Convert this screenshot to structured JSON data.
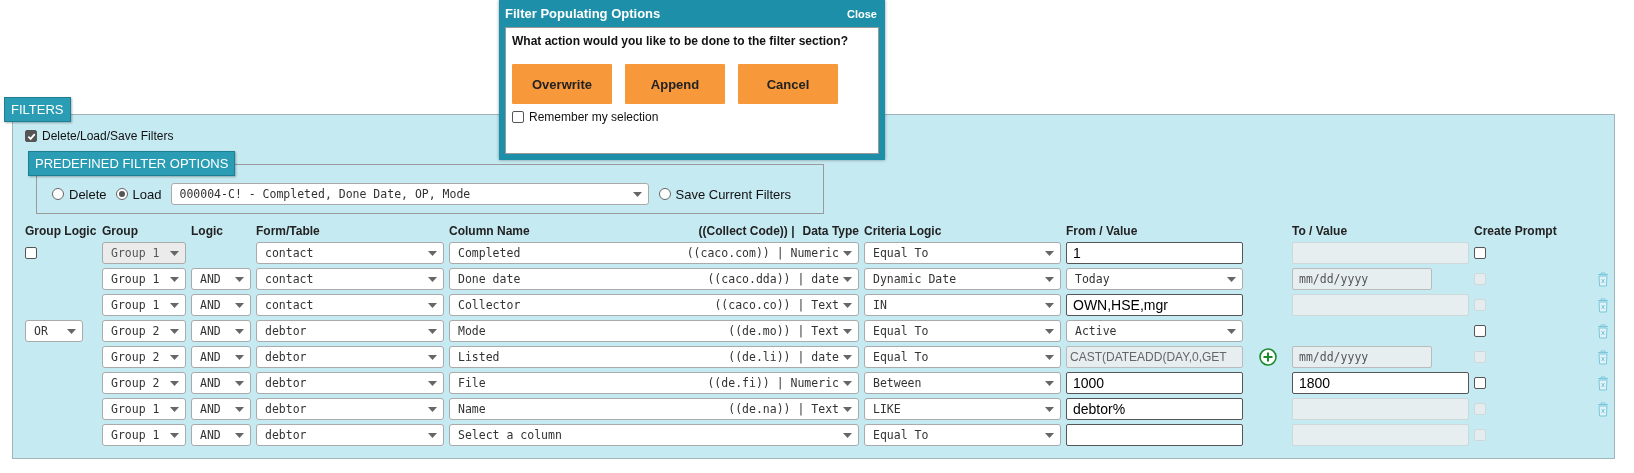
{
  "dialog": {
    "title": "Filter Populating Options",
    "close": "Close",
    "question": "What action would you like to be done to the filter section?",
    "buttons": [
      "Overwrite",
      "Append",
      "Cancel"
    ],
    "remember": {
      "label": "Remember my selection",
      "checked": false
    }
  },
  "filters": {
    "title": "FILTERS",
    "toggle": {
      "label": "Delete/Load/Save Filters",
      "checked": true
    },
    "predefined": {
      "title": "PREDEFINED FILTER OPTIONS",
      "options": [
        {
          "label": "Delete",
          "selected": false
        },
        {
          "label": "Load",
          "selected": true
        }
      ],
      "load_value": "000004-C! - Completed, Done Date, OP, Mode",
      "save": {
        "label": "Save Current Filters",
        "selected": false
      }
    },
    "headers": {
      "group_logic": "Group Logic",
      "group": "Group",
      "logic": "Logic",
      "form": "Form/Table",
      "column": "Column Name",
      "code": "((Collect Code)) |",
      "data_type": "Data Type",
      "criteria": "Criteria Logic",
      "from": "From / Value",
      "to": "To / Value",
      "prompt": "Create Prompt"
    },
    "rows": [
      {
        "group_logic": {
          "kind": "checkbox",
          "checked": false
        },
        "group": {
          "value": "Group 1",
          "disabled": true
        },
        "form": "contact",
        "column": "Completed",
        "code": "((caco.com)) | Numeric",
        "criteria": "Equal To",
        "from": {
          "kind": "input",
          "value": "1"
        },
        "add": false,
        "to": {
          "kind": "blank"
        },
        "prompt": {
          "checked": false,
          "disabled": false
        },
        "delete": false
      },
      {
        "group": {
          "value": "Group 1",
          "disabled": false
        },
        "logic": "AND",
        "form": "contact",
        "column": "Done date",
        "code": "((caco.dda)) | date",
        "criteria": "Dynamic Date",
        "from": {
          "kind": "select",
          "value": "Today"
        },
        "add": false,
        "to": {
          "kind": "date",
          "placeholder": "mm/dd/yyyy"
        },
        "prompt": {
          "checked": false,
          "disabled": true
        },
        "delete": true
      },
      {
        "group": {
          "value": "Group 1",
          "disabled": false
        },
        "logic": "AND",
        "form": "contact",
        "column": "Collector",
        "code": "((caco.co)) | Text",
        "criteria": "IN",
        "from": {
          "kind": "input",
          "value": "OWN,HSE,mgr"
        },
        "add": false,
        "to": {
          "kind": "blank"
        },
        "prompt": {
          "checked": false,
          "disabled": true
        },
        "delete": true
      },
      {
        "group_logic": {
          "kind": "select",
          "value": "OR"
        },
        "group": {
          "value": "Group 2",
          "disabled": false
        },
        "logic": "AND",
        "form": "debtor",
        "column": "Mode",
        "code": "((de.mo)) | Text",
        "criteria": "Equal To",
        "from": {
          "kind": "select",
          "value": "Active"
        },
        "add": false,
        "prompt": {
          "checked": false,
          "disabled": false
        },
        "delete": true
      },
      {
        "group": {
          "value": "Group 2",
          "disabled": false
        },
        "logic": "AND",
        "form": "debtor",
        "column": "Listed",
        "code": "((de.li)) | date",
        "criteria": "Equal To",
        "from": {
          "kind": "readonly",
          "value": "CAST(DATEADD(DAY,0,GET"
        },
        "add": true,
        "to": {
          "kind": "date",
          "placeholder": "mm/dd/yyyy"
        },
        "prompt": {
          "checked": false,
          "disabled": true
        },
        "delete": true
      },
      {
        "group": {
          "value": "Group 2",
          "disabled": false
        },
        "logic": "AND",
        "form": "debtor",
        "column": "File",
        "code": "((de.fi)) | Numeric",
        "criteria": "Between",
        "from": {
          "kind": "input",
          "value": "1000"
        },
        "add": false,
        "to": {
          "kind": "input",
          "value": "1800"
        },
        "prompt": {
          "checked": false,
          "disabled": false
        },
        "delete": true
      },
      {
        "group": {
          "value": "Group 1",
          "disabled": false
        },
        "logic": "AND",
        "form": "debtor",
        "column": "Name",
        "code": "((de.na)) | Text",
        "criteria": "LIKE",
        "from": {
          "kind": "input",
          "value": "debtor%"
        },
        "add": false,
        "to": {
          "kind": "blank"
        },
        "prompt": {
          "checked": false,
          "disabled": true
        },
        "delete": true
      },
      {
        "group": {
          "value": "Group 1",
          "disabled": false
        },
        "logic": "AND",
        "form": "debtor",
        "column": "Select a column",
        "criteria": "Equal To",
        "from": {
          "kind": "input"
        },
        "add": false,
        "to": {
          "kind": "blank"
        },
        "prompt": {
          "checked": false,
          "disabled": true
        },
        "delete": false
      }
    ]
  }
}
